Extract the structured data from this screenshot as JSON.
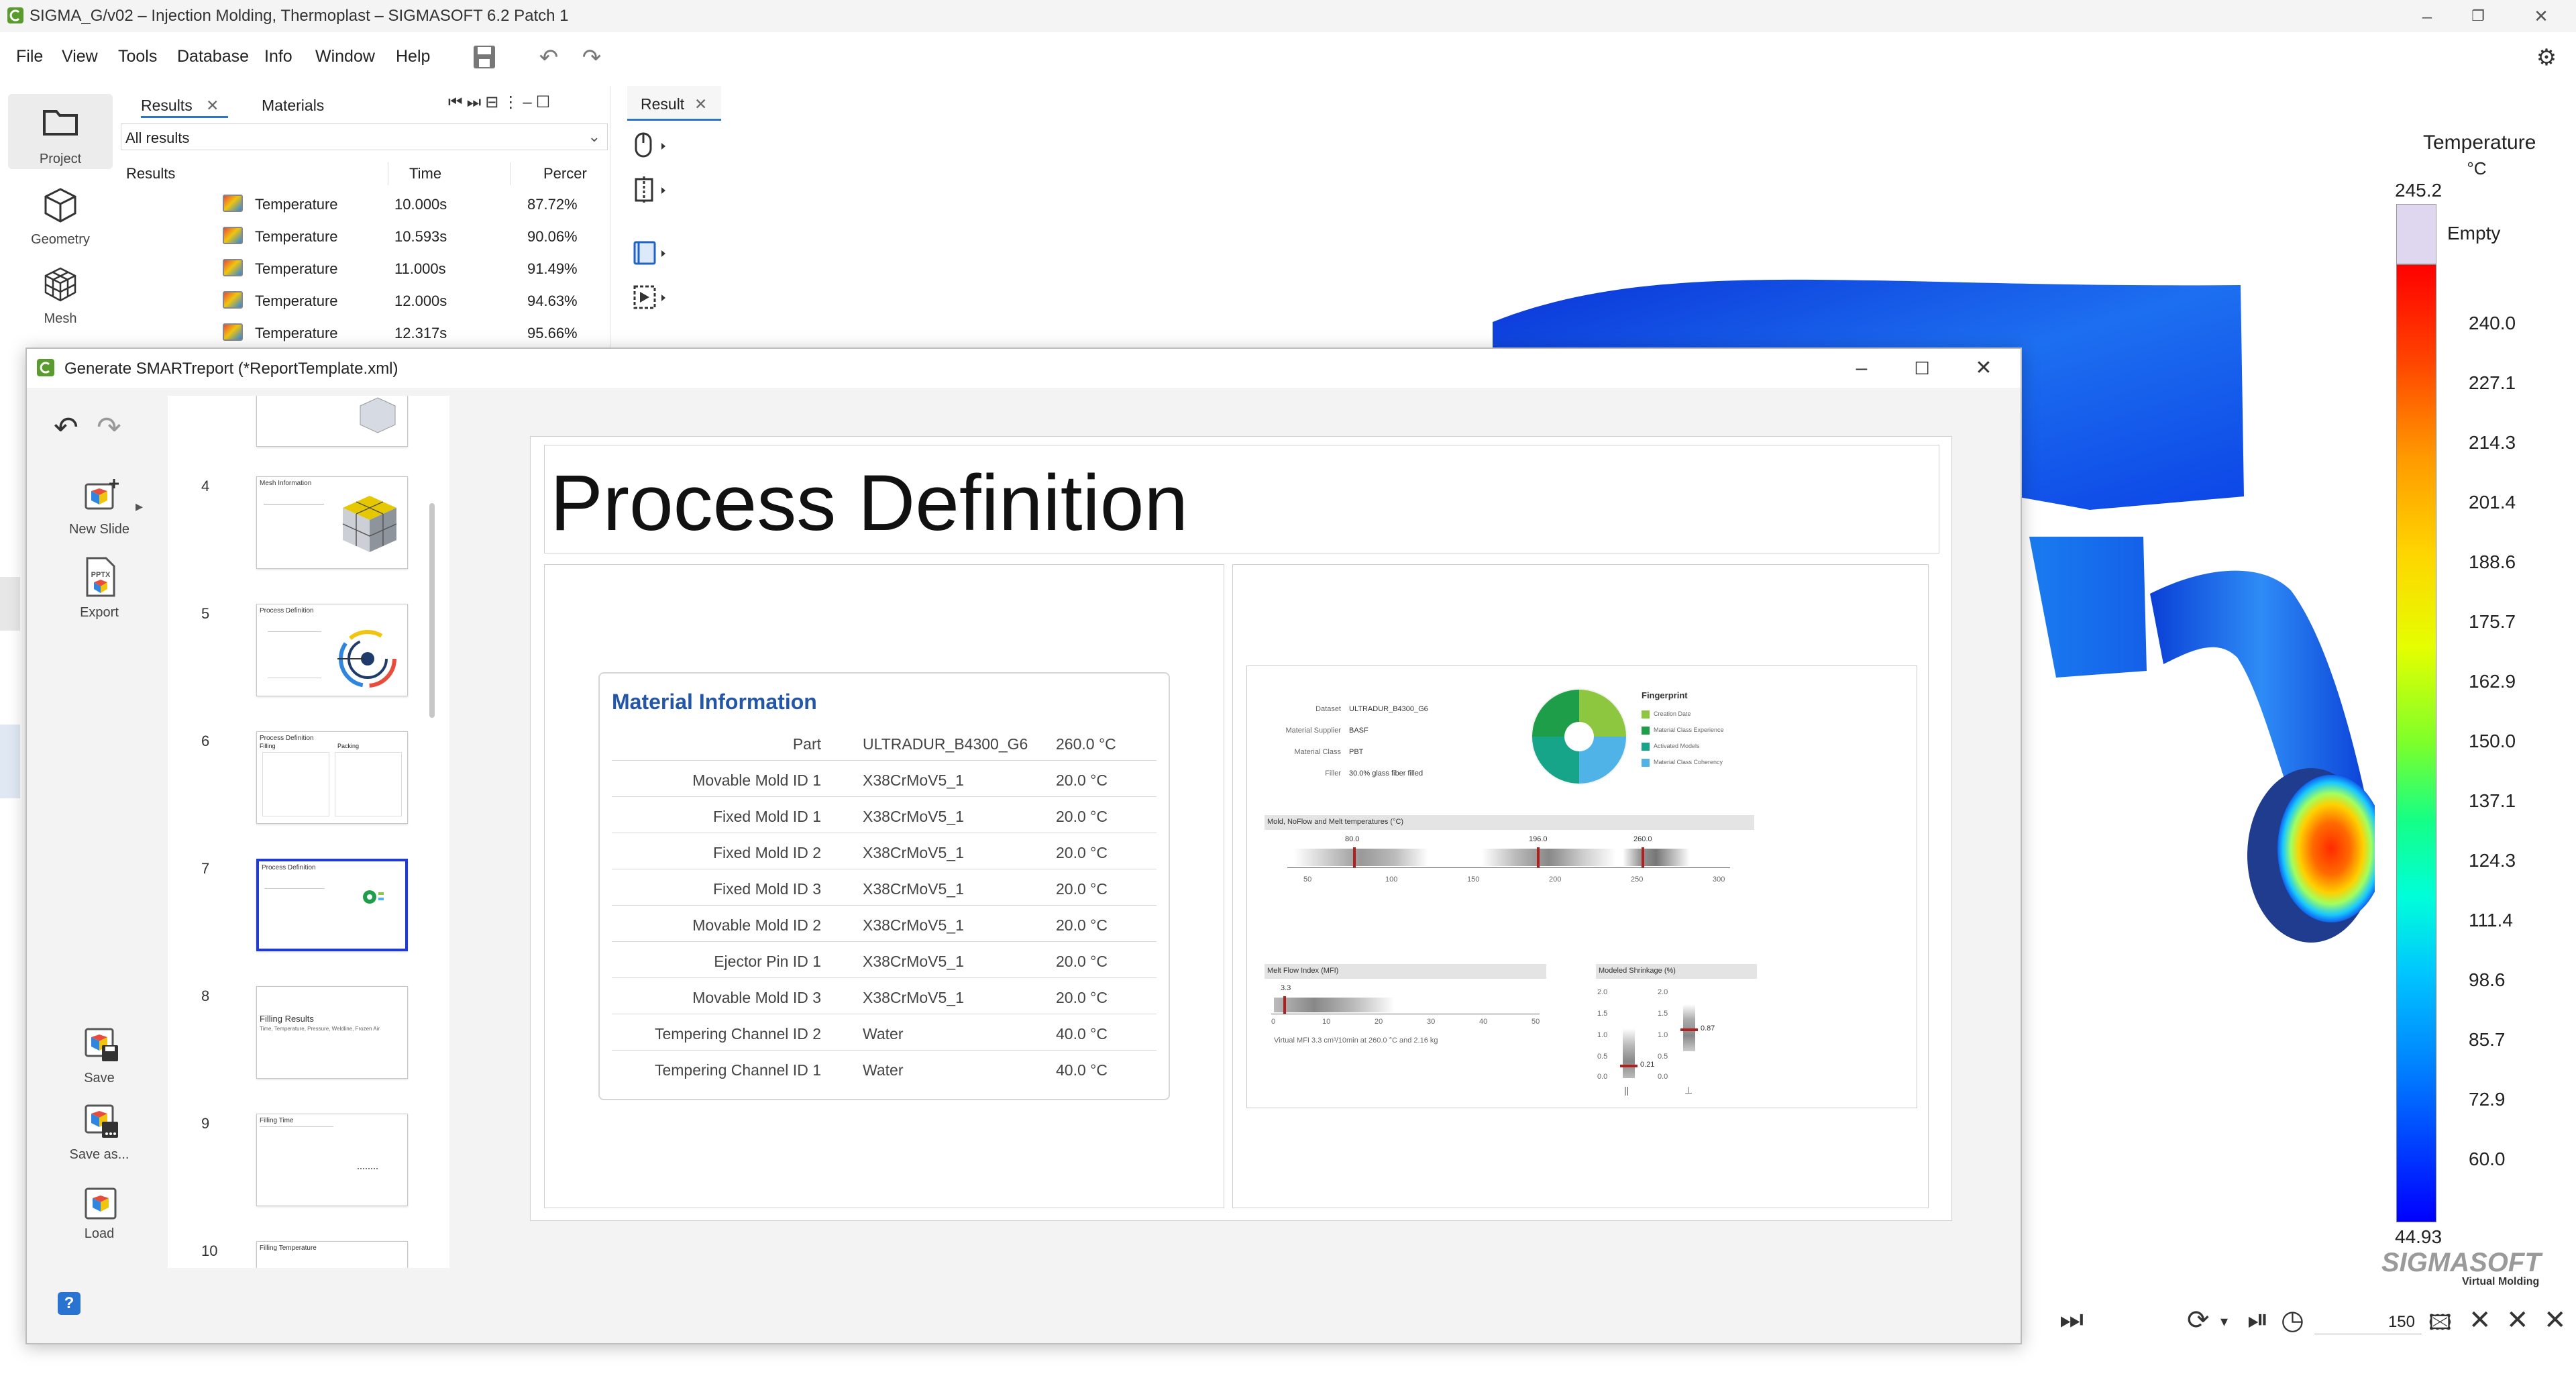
{
  "window": {
    "title": "SIGMA_G/v02  –  Injection Molding, Thermoplast  –  SIGMASOFT 6.2 Patch 1"
  },
  "menu": [
    "File",
    "View",
    "Tools",
    "Database",
    "Info",
    "Window",
    "Help"
  ],
  "left_sidebar": [
    {
      "label": "Project",
      "icon": "folder-icon"
    },
    {
      "label": "Geometry",
      "icon": "cube-icon"
    },
    {
      "label": "Mesh",
      "icon": "mesh-icon"
    }
  ],
  "results_panel": {
    "tabs": [
      "Results",
      "Materials"
    ],
    "filter": "All results",
    "columns": [
      "Results",
      "Time",
      "Percer"
    ],
    "rows": [
      {
        "name": "Temperature",
        "time": "10.000s",
        "percent": "87.72%"
      },
      {
        "name": "Temperature",
        "time": "10.593s",
        "percent": "90.06%"
      },
      {
        "name": "Temperature",
        "time": "11.000s",
        "percent": "91.49%"
      },
      {
        "name": "Temperature",
        "time": "12.000s",
        "percent": "94.63%"
      },
      {
        "name": "Temperature",
        "time": "12.317s",
        "percent": "95.66%"
      }
    ]
  },
  "result_tab": "Result",
  "legend": {
    "title": "Temperature",
    "unit": "°C",
    "max": "245.2",
    "empty_label": "Empty",
    "values": [
      "240.0",
      "227.1",
      "214.3",
      "201.4",
      "188.6",
      "175.7",
      "162.9",
      "150.0",
      "137.1",
      "124.3",
      "111.4",
      "98.6",
      "85.7",
      "72.9",
      "60.0"
    ],
    "min": "44.93",
    "brand": "SIGMASOFT",
    "brand_sub": "Virtual Molding"
  },
  "playback": {
    "frame": "150"
  },
  "dialog": {
    "title": "Generate SMARTreport (*ReportTemplate.xml)",
    "side": {
      "new_slide": "New Slide",
      "export": "Export",
      "save": "Save",
      "save_as": "Save as...",
      "load": "Load",
      "help": "?"
    },
    "thumbnails": [
      {
        "num": "4",
        "title": "Mesh Information"
      },
      {
        "num": "5",
        "title": "Process Definition"
      },
      {
        "num": "6",
        "title": "Process Definition"
      },
      {
        "num": "7",
        "title": "Process Definition"
      },
      {
        "num": "8",
        "title": "Filling Results"
      },
      {
        "num": "9",
        "title": "Filling Time"
      },
      {
        "num": "10",
        "title": "Filling Temperature"
      }
    ],
    "thumb_sub_6": [
      "Filling",
      "Packing"
    ],
    "thumb_sub_8": "Time, Temperature, Pressure, Weldline, Frozen Air",
    "slide": {
      "title": "Process Definition",
      "material": {
        "title": "Material Information",
        "rows": [
          {
            "name": "Part",
            "material": "ULTRADUR_B4300_G6",
            "value": "260.0 °C"
          },
          {
            "name": "Movable Mold ID 1",
            "material": "X38CrMoV5_1",
            "value": "20.0 °C"
          },
          {
            "name": "Fixed Mold ID 1",
            "material": "X38CrMoV5_1",
            "value": "20.0 °C"
          },
          {
            "name": "Fixed Mold ID 2",
            "material": "X38CrMoV5_1",
            "value": "20.0 °C"
          },
          {
            "name": "Fixed Mold ID 3",
            "material": "X38CrMoV5_1",
            "value": "20.0 °C"
          },
          {
            "name": "Movable Mold ID 2",
            "material": "X38CrMoV5_1",
            "value": "20.0 °C"
          },
          {
            "name": "Ejector Pin ID 1",
            "material": "X38CrMoV5_1",
            "value": "20.0 °C"
          },
          {
            "name": "Movable Mold ID 3",
            "material": "X38CrMoV5_1",
            "value": "20.0 °C"
          },
          {
            "name": "Tempering Channel ID 2",
            "material": "Water",
            "value": "40.0 °C"
          },
          {
            "name": "Tempering Channel ID 1",
            "material": "Water",
            "value": "40.0 °C"
          }
        ]
      },
      "fingerprint": {
        "fields": [
          {
            "k": "Dataset",
            "v": "ULTRADUR_B4300_G6"
          },
          {
            "k": "Material Supplier",
            "v": "BASF"
          },
          {
            "k": "Material Class",
            "v": "PBT"
          },
          {
            "k": "Filler",
            "v": "30.0% glass fiber filled"
          }
        ],
        "title": "Fingerprint",
        "legend": [
          {
            "label": "Creation Date",
            "color": "#8dc63f"
          },
          {
            "label": "Material Class Experience",
            "color": "#1f9e4a"
          },
          {
            "label": "Activated Models",
            "color": "#17a589"
          },
          {
            "label": "Material Class Coherency",
            "color": "#4fb3e8"
          }
        ],
        "temps_title": "Mold, NoFlow and Melt temperatures (°C)",
        "temps_markers": [
          "80.0",
          "196.0",
          "260.0"
        ],
        "temps_ticks": [
          "50",
          "100",
          "150",
          "200",
          "250",
          "300"
        ],
        "mfi_title": "Melt Flow Index (MFI)",
        "mfi_marker": "3.3",
        "mfi_ticks": [
          "0",
          "10",
          "20",
          "30",
          "40",
          "50"
        ],
        "mfi_note": "Virtual MFI     3.3 cm³/10min at 260.0 °C and 2.16 kg",
        "shrink_title": "Modeled Shrinkage (%)",
        "shrink_ticks": [
          "2.0",
          "1.5",
          "1.0",
          "0.5",
          "0.0"
        ],
        "shrink_values": [
          "0.21",
          "0.87"
        ],
        "shrink_symbols": [
          "||",
          "⊥"
        ]
      }
    }
  }
}
